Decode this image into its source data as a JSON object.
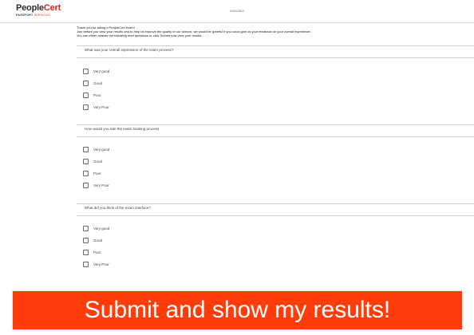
{
  "header": {
    "logo_main_part1": "People",
    "logo_main_part2": "Cert",
    "logo_sub_part1": "PASSPORT",
    "logo_sub_part2": "SERVICES",
    "date": "01/01/2012"
  },
  "intro": {
    "line1": "Thank you for taking a PeopleCert exam!",
    "line2": "Just before you view your results and to help us improve the quality of our service, we would be grateful if you could give us your feedback on your overall experience.",
    "line3": "You can either answer the following brief questions or click Submit now view your results."
  },
  "questions": [
    {
      "text": "What was your overall impression of the exam process?",
      "options": [
        "Very good",
        "Good",
        "Poor",
        "Very Poor"
      ]
    },
    {
      "text": "How would you rate the exam booking process",
      "options": [
        "Very good",
        "Good",
        "Poor",
        "Very Poor"
      ]
    },
    {
      "text": "What did you think of the exam interface?",
      "options": [
        "Very good",
        "Good",
        "Poor",
        "Very Poor"
      ]
    }
  ],
  "submit": {
    "label": "Submit and show my results!",
    "color": "#ff3d0b"
  },
  "colors": {
    "brand_red": "#e2231a",
    "submit_orange": "#ff3d0b"
  }
}
